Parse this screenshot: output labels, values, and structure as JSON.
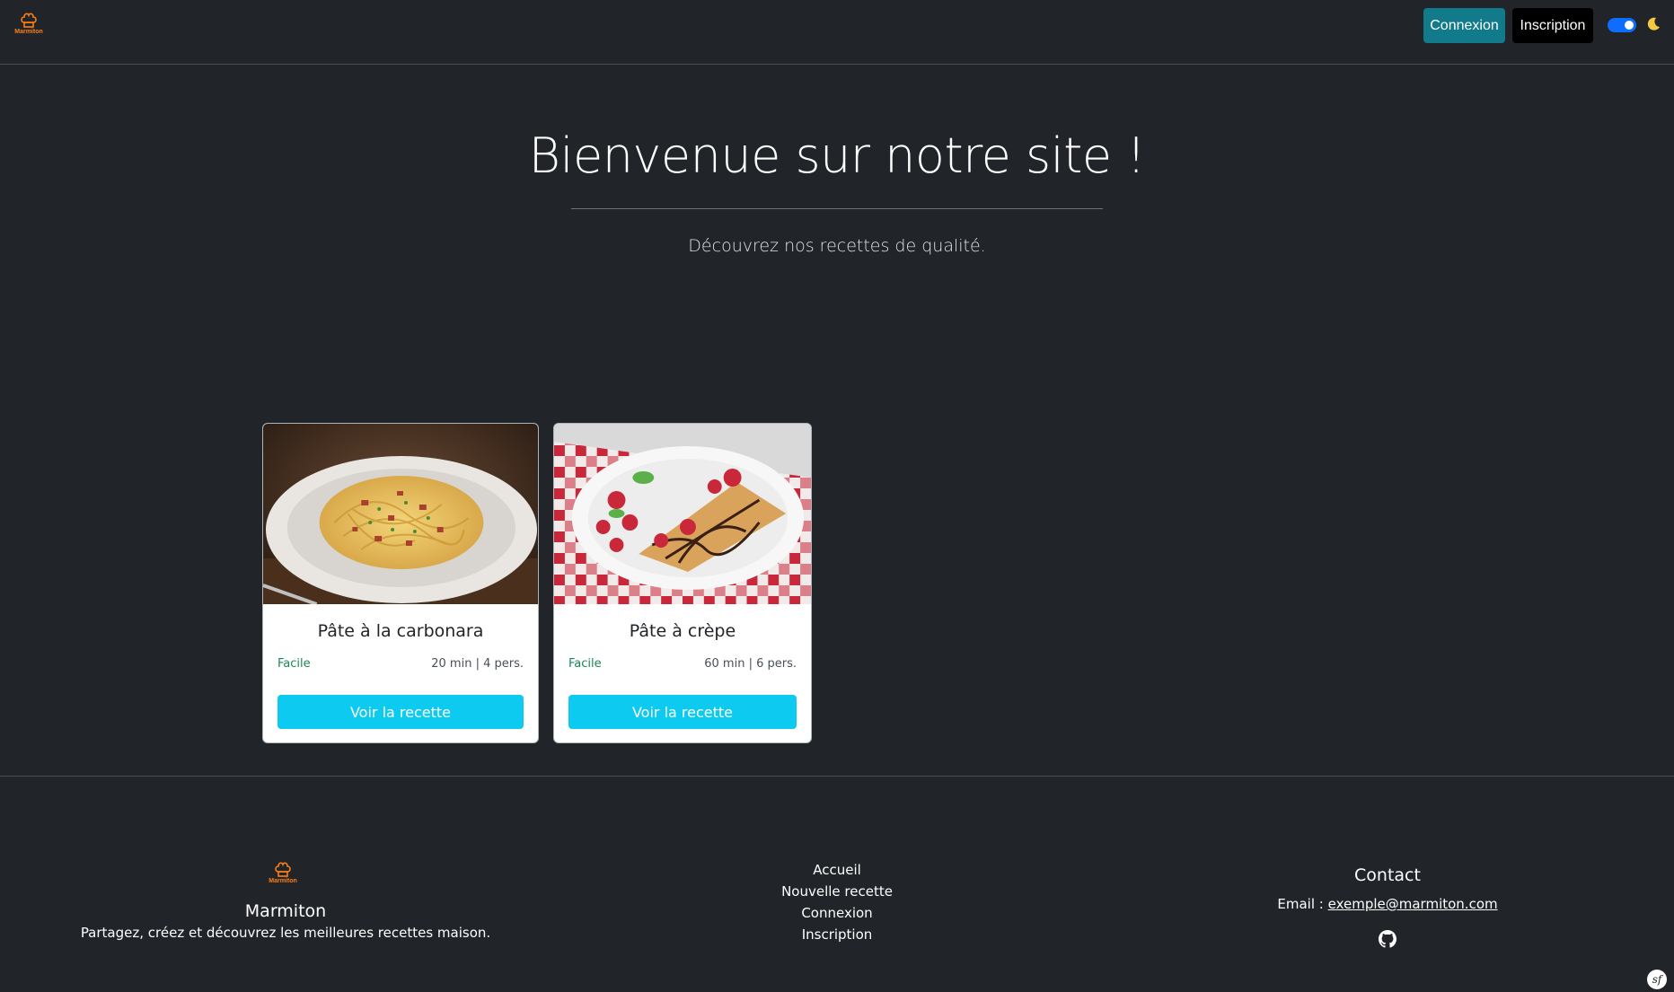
{
  "navbar": {
    "brand": "Marmiton",
    "login_label": "Connexion",
    "signup_label": "Inscription",
    "theme_toggle_on": true
  },
  "hero": {
    "title": "Bienvenue sur notre site !",
    "subtitle": "Découvrez nos recettes de qualité."
  },
  "recipes": [
    {
      "title": "Pâte à la carbonara",
      "difficulty": "Facile",
      "info": "20 min | 4 pers.",
      "button": "Voir la recette"
    },
    {
      "title": "Pâte à crèpe",
      "difficulty": "Facile",
      "info": "60 min | 6 pers.",
      "button": "Voir la recette"
    }
  ],
  "footer": {
    "brand_logo": "Marmiton",
    "brand": "Marmiton",
    "tagline": "Partagez, créez et découvrez les meilleures recettes maison.",
    "links": [
      "Accueil",
      "Nouvelle recette",
      "Connexion",
      "Inscription"
    ],
    "contact_title": "Contact",
    "email_label": "Email : ",
    "email": "exemple@marmiton.com"
  },
  "colors": {
    "background": "#212529",
    "login_button": "#117a8b",
    "card_button": "#0dcaf0",
    "difficulty": "#198754",
    "logo": "#fd7e14",
    "toggle": "#0d6efd"
  },
  "icons": [
    "chef-hat-icon",
    "moon-icon",
    "github-icon",
    "symfony-icon"
  ]
}
